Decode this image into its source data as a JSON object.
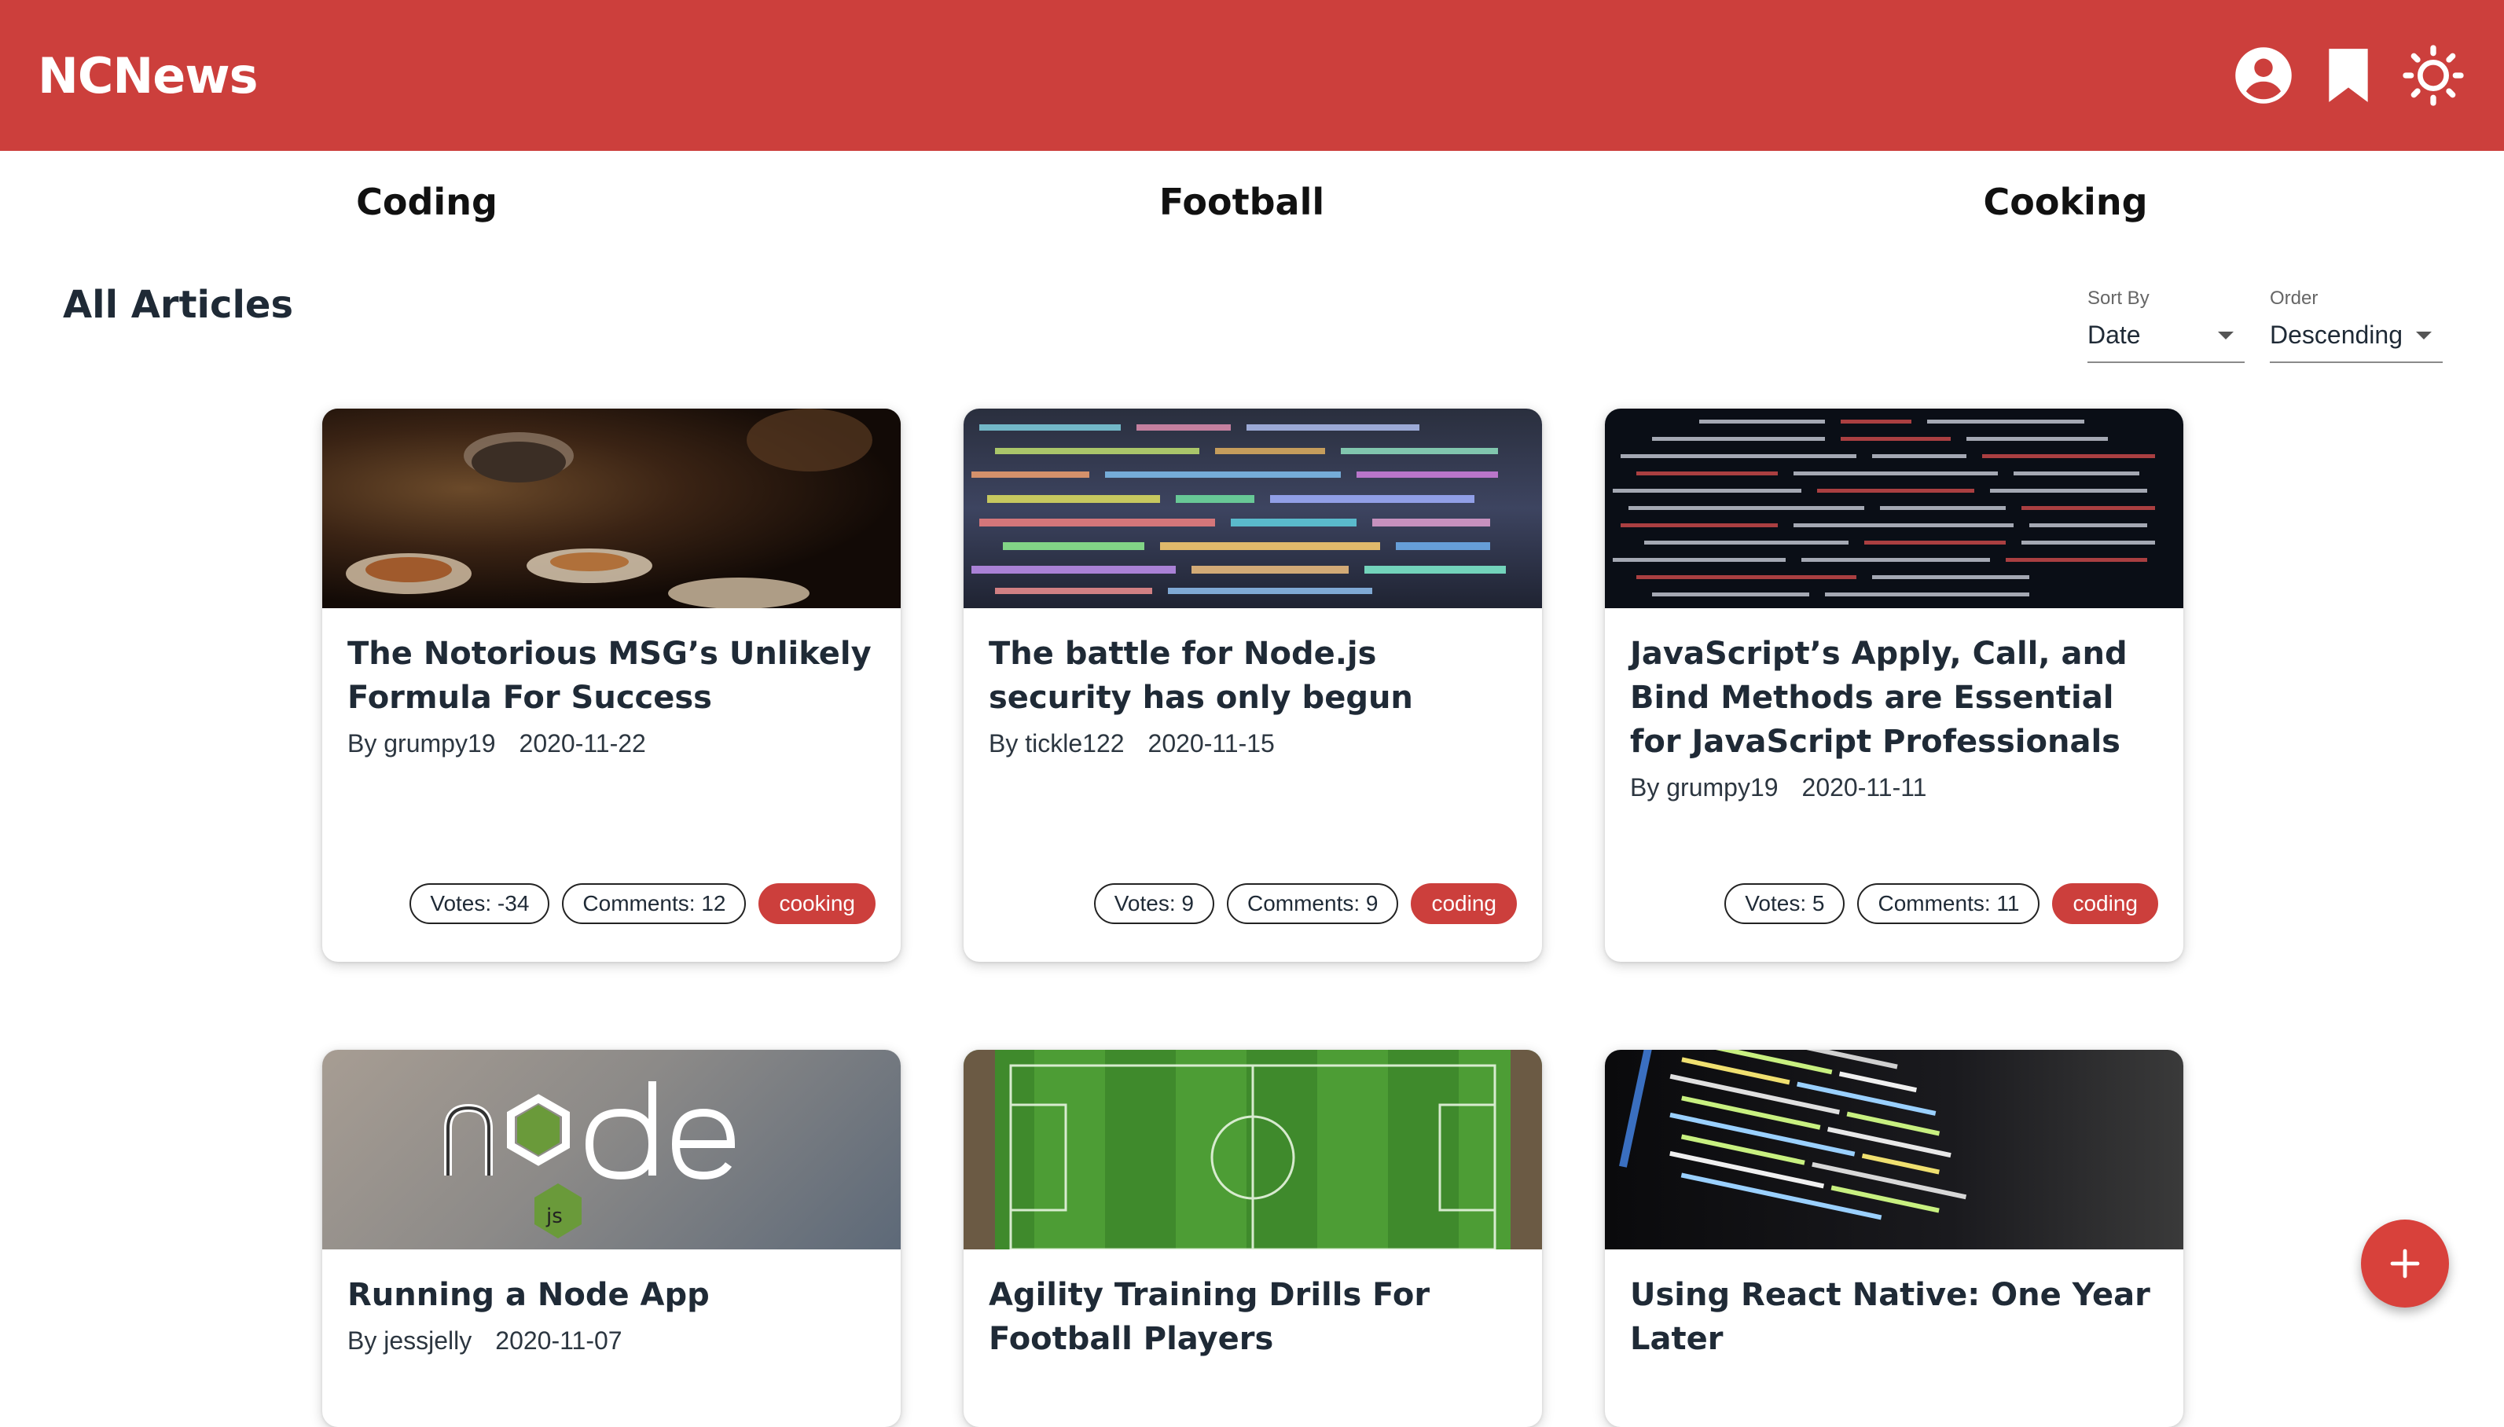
{
  "header": {
    "brand": "NCNews",
    "icons": [
      "account-circle-icon",
      "bookmark-icon",
      "brightness-icon"
    ],
    "accent_color": "#cc3f3c"
  },
  "topics": [
    "Coding",
    "Football",
    "Cooking"
  ],
  "page_title": "All Articles",
  "sort": {
    "label": "Sort By",
    "value": "Date"
  },
  "order": {
    "label": "Order",
    "value": "Descending"
  },
  "articles": [
    {
      "title": "The Notorious MSG’s Unlikely Formula For Success",
      "author": "By grumpy19",
      "date": "2020-11-22",
      "votes": "Votes: -34",
      "comments": "Comments: 12",
      "topic": "cooking"
    },
    {
      "title": "The battle for Node.js security has only begun",
      "author": "By tickle122",
      "date": "2020-11-15",
      "votes": "Votes: 9",
      "comments": "Comments: 9",
      "topic": "coding"
    },
    {
      "title": "JavaScript’s Apply, Call, and Bind Methods are Essential for JavaScript Professionals",
      "author": "By grumpy19",
      "date": "2020-11-11",
      "votes": "Votes: 5",
      "comments": "Comments: 11",
      "topic": "coding"
    },
    {
      "title": "Running a Node App",
      "author": "By jessjelly",
      "date": "2020-11-07"
    },
    {
      "title": "Agility Training Drills For Football Players"
    },
    {
      "title": "Using React Native: One Year Later"
    }
  ],
  "fab": {
    "icon": "plus-icon"
  }
}
